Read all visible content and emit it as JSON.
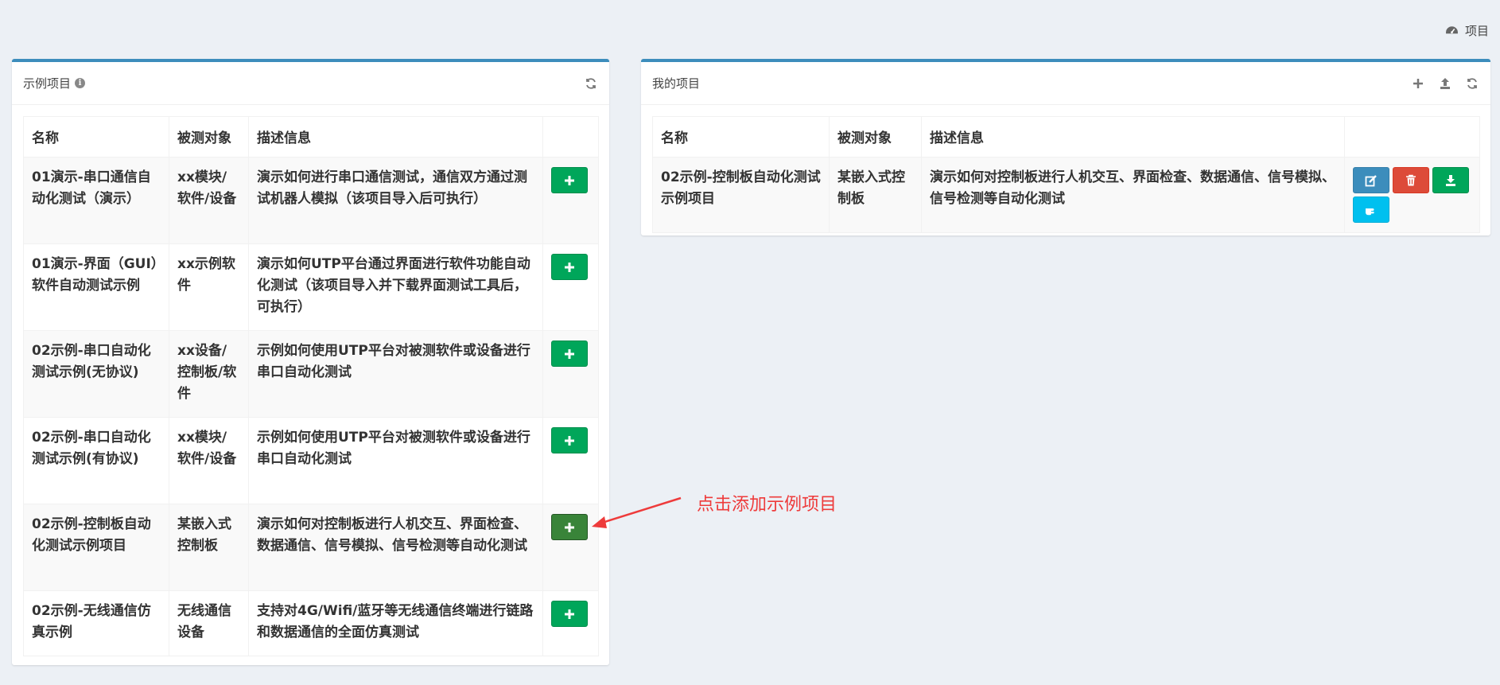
{
  "topbar": {
    "label": "项目",
    "icon": "dashboard-icon"
  },
  "left_panel": {
    "title": "示例项目",
    "columns": [
      "名称",
      "被测对象",
      "描述信息",
      ""
    ],
    "rows": [
      {
        "name": "01演示-串口通信自动化测试（演示）",
        "target": "xx模块/软件/设备",
        "desc": "演示如何进行串口通信测试，通信双方通过测试机器人模拟（该项目导入后可执行）"
      },
      {
        "name": "01演示-界面（GUI）软件自动测试示例",
        "target": "xx示例软件",
        "desc": "演示如何UTP平台通过界面进行软件功能自动化测试（该项目导入并下载界面测试工具后，可执行）"
      },
      {
        "name": "02示例-串口自动化测试示例(无协议)",
        "target": "xx设备/控制板/软件",
        "desc": "示例如何使用UTP平台对被测软件或设备进行串口自动化测试"
      },
      {
        "name": "02示例-串口自动化测试示例(有协议)",
        "target": "xx模块/软件/设备",
        "desc": "示例如何使用UTP平台对被测软件或设备进行串口自动化测试"
      },
      {
        "name": "02示例-控制板自动化测试示例项目",
        "target": "某嵌入式控制板",
        "desc": "演示如何对控制板进行人机交互、界面检查、数据通信、信号模拟、信号检测等自动化测试"
      },
      {
        "name": "02示例-无线通信仿真示例",
        "target": "无线通信设备",
        "desc": "支持对4G/Wifi/蓝牙等无线通信终端进行链路和数据通信的全面仿真测试"
      }
    ]
  },
  "right_panel": {
    "title": "我的项目",
    "columns": [
      "名称",
      "被测对象",
      "描述信息",
      ""
    ],
    "rows": [
      {
        "name": "02示例-控制板自动化测试示例项目",
        "target": "某嵌入式控制板",
        "desc": "演示如何对控制板进行人机交互、界面检查、数据通信、信号模拟、信号检测等自动化测试"
      }
    ]
  },
  "annotation": {
    "text": "点击添加示例项目",
    "color": "#ee3b3b"
  },
  "colors": {
    "accent": "#3c8dbc",
    "success": "#00a65a",
    "danger": "#dd4b39",
    "info": "#00c0ef",
    "background": "#ecf0f5"
  }
}
